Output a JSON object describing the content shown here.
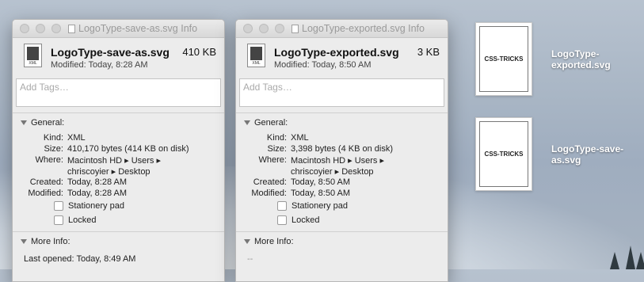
{
  "window_left": {
    "title": "LogoType-save-as.svg Info",
    "filename": "LogoType-save-as.svg",
    "size": "410 KB",
    "modified": "Modified: Today, 8:28 AM",
    "file_icon_tag": "XML",
    "tags_placeholder": "Add Tags…",
    "general_label": "General:",
    "labels": {
      "kind": "Kind:",
      "size": "Size:",
      "where": "Where:",
      "created": "Created:",
      "modified": "Modified:"
    },
    "kind": "XML",
    "size_detail": "410,170 bytes (414 KB on disk)",
    "where_line1": "Macintosh HD ▸ Users ▸",
    "where_line2": "chriscoyier ▸ Desktop",
    "created": "Today, 8:28 AM",
    "modified_value": "Today, 8:28 AM",
    "stationery": "Stationery pad",
    "locked": "Locked",
    "more_info_label": "More Info:",
    "more_info_text": "Last opened: Today, 8:49 AM"
  },
  "window_right": {
    "title": "LogoType-exported.svg Info",
    "filename": "LogoType-exported.svg",
    "size": "3 KB",
    "modified": "Modified: Today, 8:50 AM",
    "file_icon_tag": "XML",
    "tags_placeholder": "Add Tags…",
    "general_label": "General:",
    "labels": {
      "kind": "Kind:",
      "size": "Size:",
      "where": "Where:",
      "created": "Created:",
      "modified": "Modified:"
    },
    "kind": "XML",
    "size_detail": "3,398 bytes (4 KB on disk)",
    "where_line1": "Macintosh HD ▸ Users ▸",
    "where_line2": "chriscoyier ▸ Desktop",
    "created": "Today, 8:50 AM",
    "modified_value": "Today, 8:50 AM",
    "stationery": "Stationery pad",
    "locked": "Locked",
    "more_info_label": "More Info:",
    "more_info_text": "--"
  },
  "desktop": {
    "icon1_label": "LogoType-exported.svg",
    "icon1_thumb_text": "CSS-TRICKS",
    "icon2_label": "LogoType-save-as.svg",
    "icon2_thumb_text": "CSS-TRICKS"
  }
}
